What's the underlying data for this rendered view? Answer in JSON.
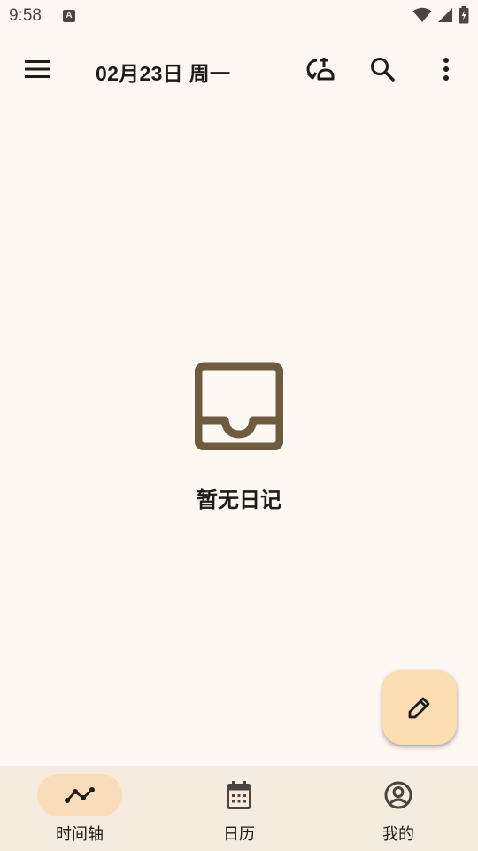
{
  "status_bar": {
    "time": "9:58",
    "notification_glyph": "A",
    "icons": [
      "wifi-icon",
      "signal-icon",
      "battery-charging-icon"
    ]
  },
  "app_bar": {
    "title": "02月23日 周一",
    "icons": [
      "menu-icon",
      "sync-icon",
      "search-icon",
      "more-vert-icon"
    ]
  },
  "empty_state": {
    "icon": "inbox-icon",
    "label": "暂无日记"
  },
  "fab": {
    "icon": "edit-icon"
  },
  "bottom_nav": {
    "items": [
      {
        "label": "时间轴",
        "icon": "timeline-icon",
        "active": true
      },
      {
        "label": "日历",
        "icon": "calendar-icon",
        "active": false
      },
      {
        "label": "我的",
        "icon": "account-icon",
        "active": false
      }
    ]
  },
  "colors": {
    "background": "#fdf8f2",
    "icon": "#6f5b40",
    "fab": "#ffddb3",
    "nav_background": "#f6ebdf",
    "nav_active_pill": "#f9ddbb",
    "text": "#1f1b16"
  }
}
